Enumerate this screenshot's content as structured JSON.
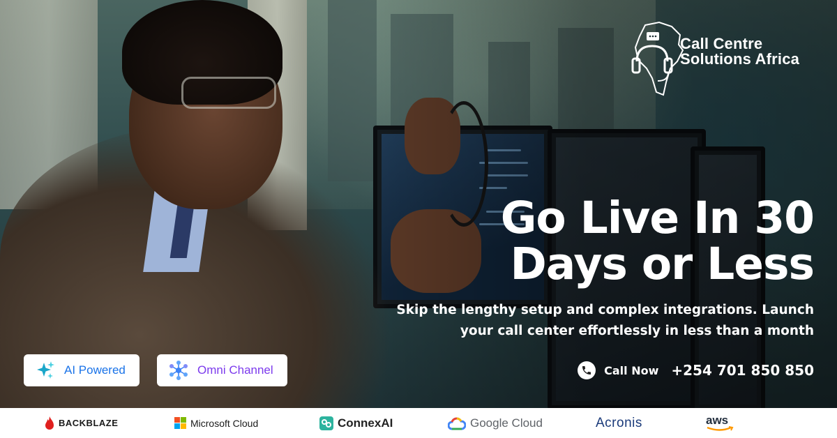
{
  "brand": {
    "name_line1": "Call Centre",
    "name_line2": "Solutions Africa"
  },
  "hero": {
    "headline_line1": "Go Live In 30",
    "headline_line2": "Days or Less",
    "subline_line1": "Skip the lengthy setup and complex integrations. Launch",
    "subline_line2": "your call center effortlessly in less than a month"
  },
  "contact": {
    "call_label": "Call Now",
    "phone": "+254 701 850 850"
  },
  "badges": [
    {
      "label": "AI Powered",
      "icon": "sparkle-icon",
      "color": "#1a73e8"
    },
    {
      "label": "Omni Channel",
      "icon": "network-icon",
      "color": "#7c3aed"
    }
  ],
  "partners": [
    {
      "name": "BACKBLAZE",
      "icon": "flame-icon",
      "color": "#e0201f"
    },
    {
      "name": "Microsoft Cloud",
      "icon": "windows-grid-icon"
    },
    {
      "name": "ConnexAI",
      "icon": "connex-icon",
      "color": "#2db39e"
    },
    {
      "name": "Google Cloud",
      "icon": "google-cloud-icon"
    },
    {
      "name": "Acronis",
      "icon": "none",
      "color": "#1a3a7a"
    },
    {
      "name": "aws",
      "icon": "amazon-smile-icon",
      "color": "#ff9900"
    }
  ],
  "colors": {
    "text_on_photo": "#ffffff",
    "partner_bar": "#ffffff"
  }
}
